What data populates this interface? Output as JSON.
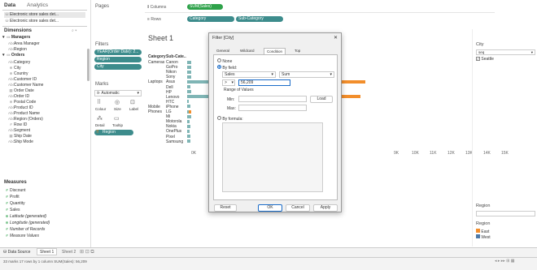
{
  "data_pane": {
    "tab_data": "Data",
    "tab_analytics": "Analytics",
    "sources": [
      "Electronic store sales det...",
      "Electronic store sales det..."
    ],
    "dimensions_label": "Dimensions",
    "managers_label": "Managers",
    "orders_label": "Orders",
    "measures_label": "Measures",
    "dim_items": [
      {
        "icon": "Abc",
        "label": "Area Manager",
        "indent": 2
      },
      {
        "icon": "Abc",
        "label": "Region",
        "indent": 2
      },
      {
        "icon": "Abc",
        "label": "Category",
        "indent": 2
      },
      {
        "icon": "⊕",
        "label": "City",
        "indent": 2
      },
      {
        "icon": "⊕",
        "label": "Country",
        "indent": 2
      },
      {
        "icon": "Abc",
        "label": "Customer ID",
        "indent": 2
      },
      {
        "icon": "Abc",
        "label": "Customer Name",
        "indent": 2
      },
      {
        "icon": "▦",
        "label": "Order Date",
        "indent": 2
      },
      {
        "icon": "Abc",
        "label": "Order ID",
        "indent": 2
      },
      {
        "icon": "⊕",
        "label": "Postal Code",
        "indent": 2
      },
      {
        "icon": "Abc",
        "label": "Product ID",
        "indent": 2
      },
      {
        "icon": "Abc",
        "label": "Product Name",
        "indent": 2
      },
      {
        "icon": "Abc",
        "label": "Region (Orders)",
        "indent": 2
      },
      {
        "icon": "#",
        "label": "Row ID",
        "indent": 2
      },
      {
        "icon": "Abc",
        "label": "Segment",
        "indent": 2
      },
      {
        "icon": "▦",
        "label": "Ship Date",
        "indent": 2
      },
      {
        "icon": "Abc",
        "label": "Ship Mode",
        "indent": 2
      }
    ],
    "measure_items": [
      {
        "icon": "#",
        "label": "Discount"
      },
      {
        "icon": "#",
        "label": "Profit"
      },
      {
        "icon": "#",
        "label": "Quantity"
      },
      {
        "icon": "#",
        "label": "Sales"
      },
      {
        "icon": "⊕",
        "label": "Latitude (generated)"
      },
      {
        "icon": "⊕",
        "label": "Longitude (generated)"
      },
      {
        "icon": "#",
        "label": "Number of Records"
      },
      {
        "icon": "#",
        "label": "Measure Values"
      }
    ]
  },
  "cards": {
    "pages": "Pages",
    "filters": "Filters",
    "filter_pills": [
      "YEAR(Order Date): 2...",
      "Region",
      "City"
    ],
    "marks": "Marks",
    "marks_type": "Automatic",
    "mark_buttons": [
      "Colour",
      "Size",
      "Label",
      "Detail",
      "Tooltip"
    ],
    "region_pill": "Region"
  },
  "shelves": {
    "columns_label": "Columns",
    "columns_pill": "SUM(Sales)",
    "rows_label": "Rows",
    "rows_pills": [
      "Category",
      "Sub-Category"
    ]
  },
  "sheet": {
    "title": "Sheet 1",
    "col_category": "Category",
    "col_subcat": "Sub-Cate..",
    "categories": [
      {
        "label": "Cameras",
        "row": 0
      },
      {
        "label": "Laptops",
        "row": 4
      },
      {
        "label": "Mobile Phones",
        "row": 9
      }
    ],
    "subcats": [
      "Canon",
      "GoPro",
      "Nikon",
      "Sony",
      "Asus",
      "Dell",
      "HP",
      "Lenovo",
      "HTC",
      "iPhone",
      "LG",
      "Mi",
      "Motorola",
      "Nokia",
      "OnePlus",
      "Pixel",
      "Samsung"
    ],
    "axis_ticks": [
      "0K",
      "1K",
      "9K",
      "10K",
      "11K",
      "12K",
      "13K",
      "14K",
      "15K"
    ]
  },
  "chart_data": {
    "type": "bar",
    "orientation": "horizontal",
    "categories": [
      "Canon",
      "GoPro",
      "Nikon",
      "Sony",
      "Asus",
      "Dell",
      "HP",
      "Lenovo",
      "HTC",
      "iPhone",
      "LG",
      "Mi",
      "Motorola",
      "Nokia",
      "OnePlus",
      "Pixel",
      "Samsung"
    ],
    "series": [
      {
        "name": "East",
        "color": "#f28e2b",
        "values": [
          null,
          null,
          null,
          null,
          9800,
          null,
          null,
          9500,
          null,
          null,
          220,
          null,
          null,
          null,
          null,
          null,
          null
        ]
      },
      {
        "name": "West",
        "color": "#7fb5b5",
        "values": [
          220,
          220,
          220,
          220,
          5800,
          160,
          220,
          5600,
          100,
          180,
          80,
          220,
          120,
          160,
          140,
          200,
          180
        ]
      }
    ],
    "xlabel": "",
    "ylabel": "",
    "xlim": [
      0,
      15500
    ]
  },
  "dialog": {
    "title": "Filter [City]",
    "close": "✕",
    "tabs": [
      "General",
      "Wildcard",
      "Condition",
      "Top"
    ],
    "active_tab": 2,
    "none_label": "None",
    "by_field_label": "By field:",
    "field": "Sales",
    "agg": "Sum",
    "operator": ">",
    "value": "56,209",
    "range_label": "Range of Values",
    "min_label": "Min:",
    "max_label": "Max:",
    "load": "Load",
    "by_formula_label": "By formula:",
    "buttons": {
      "reset": "Reset",
      "ok": "OK",
      "cancel": "Cancel",
      "apply": "Apply"
    }
  },
  "right_pane": {
    "city_title": "City",
    "city_search": "seq",
    "city_option": "Seattle",
    "region_title": "Region",
    "region_title2": "Region",
    "legend": [
      {
        "label": "East",
        "color": "#f28e2b"
      },
      {
        "label": "West",
        "color": "#4e79a7"
      }
    ]
  },
  "bottom": {
    "data_source": "Data Source",
    "sheets": [
      "Sheet 1",
      "Sheet 2"
    ],
    "status": "33 marks   17 rows by 1 column   SUM(Sales): 56,209"
  }
}
